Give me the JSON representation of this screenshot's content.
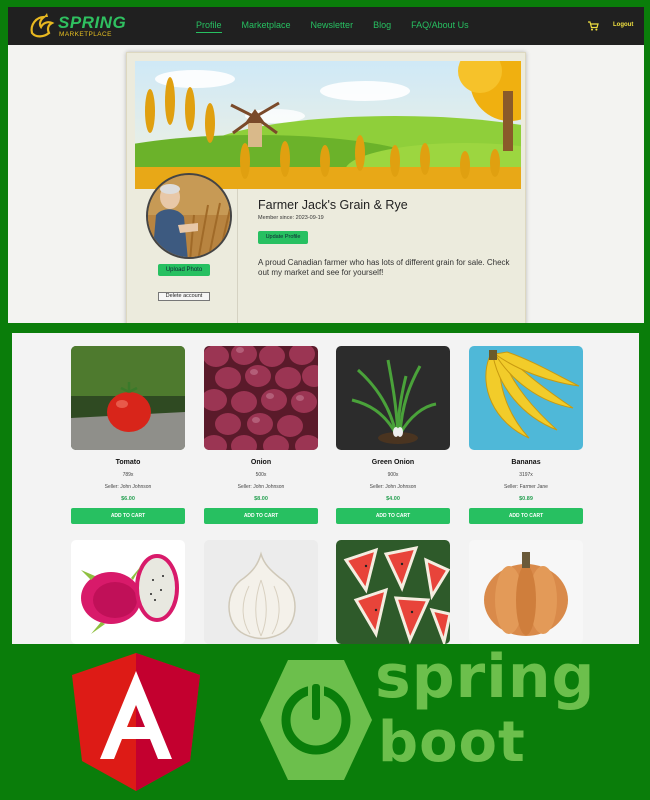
{
  "nav": {
    "brand": "SPRING",
    "brand_sub": "MARKETPLACE",
    "links": [
      "Profile",
      "Marketplace",
      "Newsletter",
      "Blog",
      "FAQ/About Us"
    ],
    "active": "Profile",
    "cart_icon": "cart-icon",
    "logout": "Logout"
  },
  "profile": {
    "name": "Farmer Jack's Grain & Rye",
    "member_since": "Member since: 2023-09-19",
    "update_button": "Update Profile",
    "upload_button": "Upload Photo",
    "delete_button": "Delete account",
    "bio": "A proud Canadian farmer who has lots of different grain for sale. Check out my market and see for yourself!"
  },
  "products": [
    {
      "name": "Tomato",
      "qty": "789x",
      "seller": "Seller: John Johnson",
      "price": "$6.00",
      "button": "ADD TO CART"
    },
    {
      "name": "Onion",
      "qty": "500x",
      "seller": "Seller: John Johnson",
      "price": "$8.00",
      "button": "ADD TO CART"
    },
    {
      "name": "Green Onion",
      "qty": "900x",
      "seller": "Seller: John Johnson",
      "price": "$4.00",
      "button": "ADD TO CART"
    },
    {
      "name": "Bananas",
      "qty": "3197x",
      "seller": "Seller: Farmer Jane",
      "price": "$0.89",
      "button": "ADD TO CART"
    }
  ],
  "second_row_images": [
    "dragon-fruit",
    "garlic",
    "watermelon",
    "pumpkin"
  ],
  "logos": {
    "angular_letter": "A",
    "spring_word": "spring",
    "boot_word": "boot"
  },
  "colors": {
    "background": "#0a7d0a",
    "accent_green": "#27c061",
    "navbar": "#202020",
    "spring_boot_green": "#6cbf4c",
    "angular_red": "#dd1b16"
  }
}
